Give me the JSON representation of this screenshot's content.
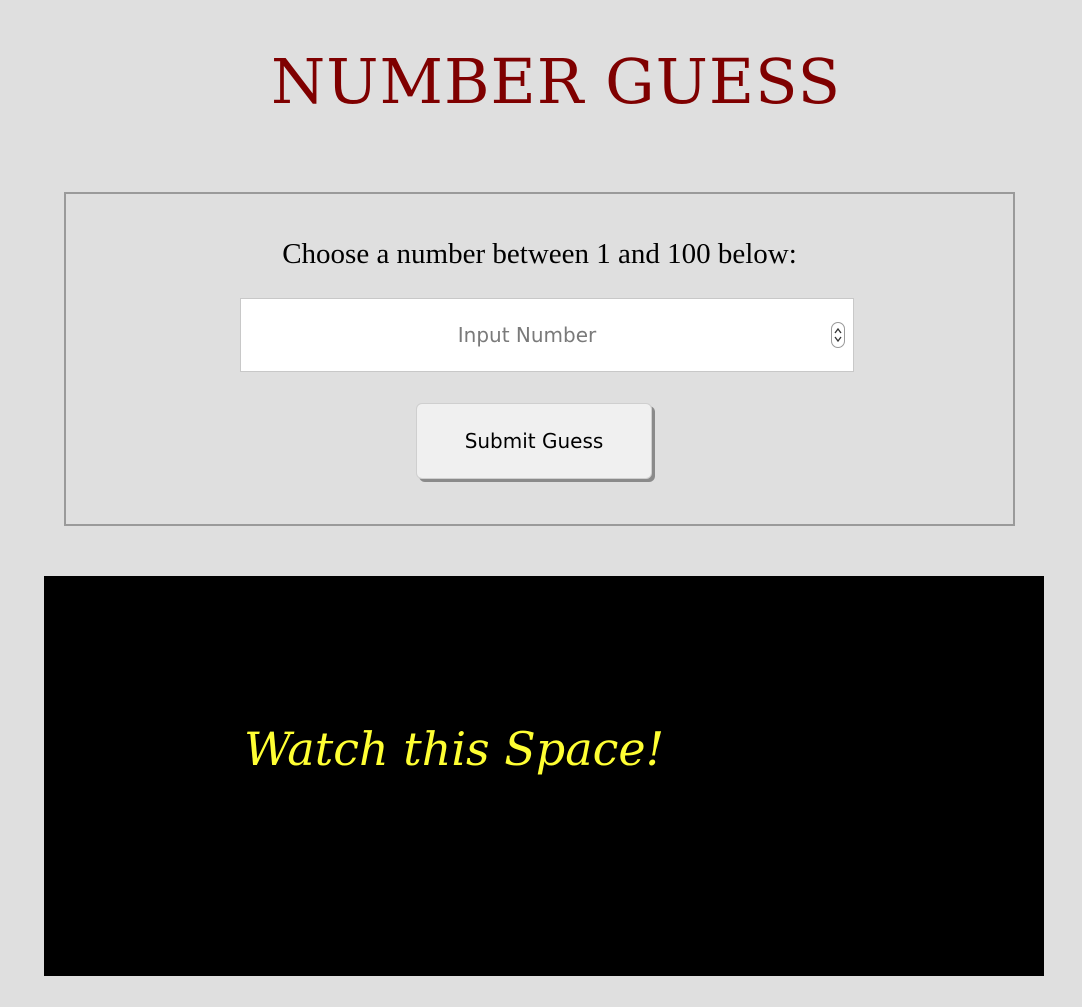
{
  "header": {
    "title": "NUMBER GUESS"
  },
  "form": {
    "prompt": "Choose a number between 1 and 100 below:",
    "input_placeholder": "Input Number",
    "input_value": "",
    "submit_label": "Submit Guess"
  },
  "message": {
    "text": "Watch this Space!"
  },
  "colors": {
    "background": "#dfdfdf",
    "title": "#7f0000",
    "message_panel": "#000000",
    "message_text": "#ffff33"
  },
  "icons": {
    "stepper": "chevron-up-down-icon"
  }
}
